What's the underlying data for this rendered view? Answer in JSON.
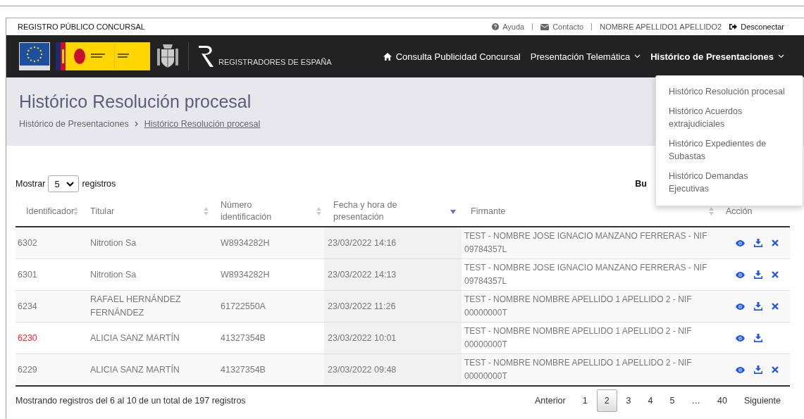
{
  "top_bar": {
    "title": "REGISTRO PÚBLICO CONCURSAL",
    "links": [
      {
        "kind": "help",
        "label": "Ayuda"
      },
      {
        "kind": "contact",
        "label": "Contacto"
      }
    ],
    "user": "NOMBRE APELLIDO1 APELLIDO2",
    "logout": "Desconectar"
  },
  "nav": {
    "brand": "REGISTRADORES DE ESPAÑA",
    "items": [
      {
        "label": "Consulta Publicidad Concursal",
        "kind": "home",
        "has_dropdown": false,
        "selected": false
      },
      {
        "label": "Presentación Telemática",
        "has_dropdown": true,
        "selected": false
      },
      {
        "label": "Histórico de Presentaciones",
        "has_dropdown": true,
        "selected": true
      }
    ]
  },
  "dropdown": {
    "items": [
      "Histórico Resolución procesal",
      "Histórico Acuerdos extrajudiciales",
      "Histórico Expedientes de Subastas",
      "Histórico Demandas Ejecutivas"
    ]
  },
  "page": {
    "title": "Histórico Resolución procesal",
    "breadcrumb": [
      {
        "label": "Histórico de Presentaciones",
        "current": false
      },
      {
        "label": "Histórico Resolución procesal",
        "current": true
      }
    ]
  },
  "table": {
    "length_before": "Mostrar",
    "length_value": "5",
    "length_after": "registros",
    "search_label": "Bu",
    "columns": [
      {
        "label": "Identificador",
        "sortable": true,
        "sorted": false
      },
      {
        "label": "Titular",
        "sortable": true,
        "sorted": false
      },
      {
        "label": "Número identificación",
        "sortable": true,
        "sorted": false
      },
      {
        "label": "Fecha y hora de presentación",
        "sortable": true,
        "sorted": true
      },
      {
        "label": "Firmante",
        "sortable": true,
        "sorted": false
      },
      {
        "label": "Acción",
        "sortable": false,
        "sorted": false
      }
    ],
    "rows": [
      {
        "id": "6302",
        "highlighted": false,
        "titular": "Nitrotion Sa",
        "numero": "W8934282H",
        "fecha": "23/03/2022 14:16",
        "firmante": "TEST - NOMBRE JOSE IGNACIO MANZANO FERRERAS - NIF 09784357L",
        "deletable": true
      },
      {
        "id": "6301",
        "highlighted": false,
        "titular": "Nitrotion Sa",
        "numero": "W8934282H",
        "fecha": "23/03/2022 14:13",
        "firmante": "TEST - NOMBRE JOSE IGNACIO MANZANO FERRERAS - NIF 09784357L",
        "deletable": true
      },
      {
        "id": "6234",
        "highlighted": false,
        "titular": "RAFAEL HERNÁNDEZ FERNÁNDEZ",
        "numero": "61722550A",
        "fecha": "23/03/2022 11:26",
        "firmante": "TEST - NOMBRE NOMBRE APELLIDO 1 APELLIDO 2 - NIF 00000000T",
        "deletable": true
      },
      {
        "id": "6230",
        "highlighted": true,
        "titular": "ALICIA SANZ MARTÍN",
        "numero": "41327354B",
        "fecha": "23/03/2022 10:01",
        "firmante": "TEST - NOMBRE NOMBRE APELLIDO 1 APELLIDO 2 - NIF 00000000T",
        "deletable": false
      },
      {
        "id": "6229",
        "highlighted": false,
        "titular": "ALICIA SANZ MARTÍN",
        "numero": "41327354B",
        "fecha": "23/03/2022 09:48",
        "firmante": "TEST - NOMBRE NOMBRE APELLIDO 1 APELLIDO 2 - NIF 00000000T",
        "deletable": true
      }
    ],
    "info": "Mostrando registros del 6 al 10 de un total de 197 registros",
    "pagination": {
      "previous": "Anterior",
      "next": "Siguiente",
      "pages": [
        {
          "label": "1",
          "selected": false
        },
        {
          "label": "2",
          "selected": true
        },
        {
          "label": "3",
          "selected": false
        },
        {
          "label": "4",
          "selected": false
        },
        {
          "label": "5",
          "selected": false
        },
        {
          "label": "…",
          "selected": false
        },
        {
          "label": "40",
          "selected": false
        }
      ]
    }
  }
}
